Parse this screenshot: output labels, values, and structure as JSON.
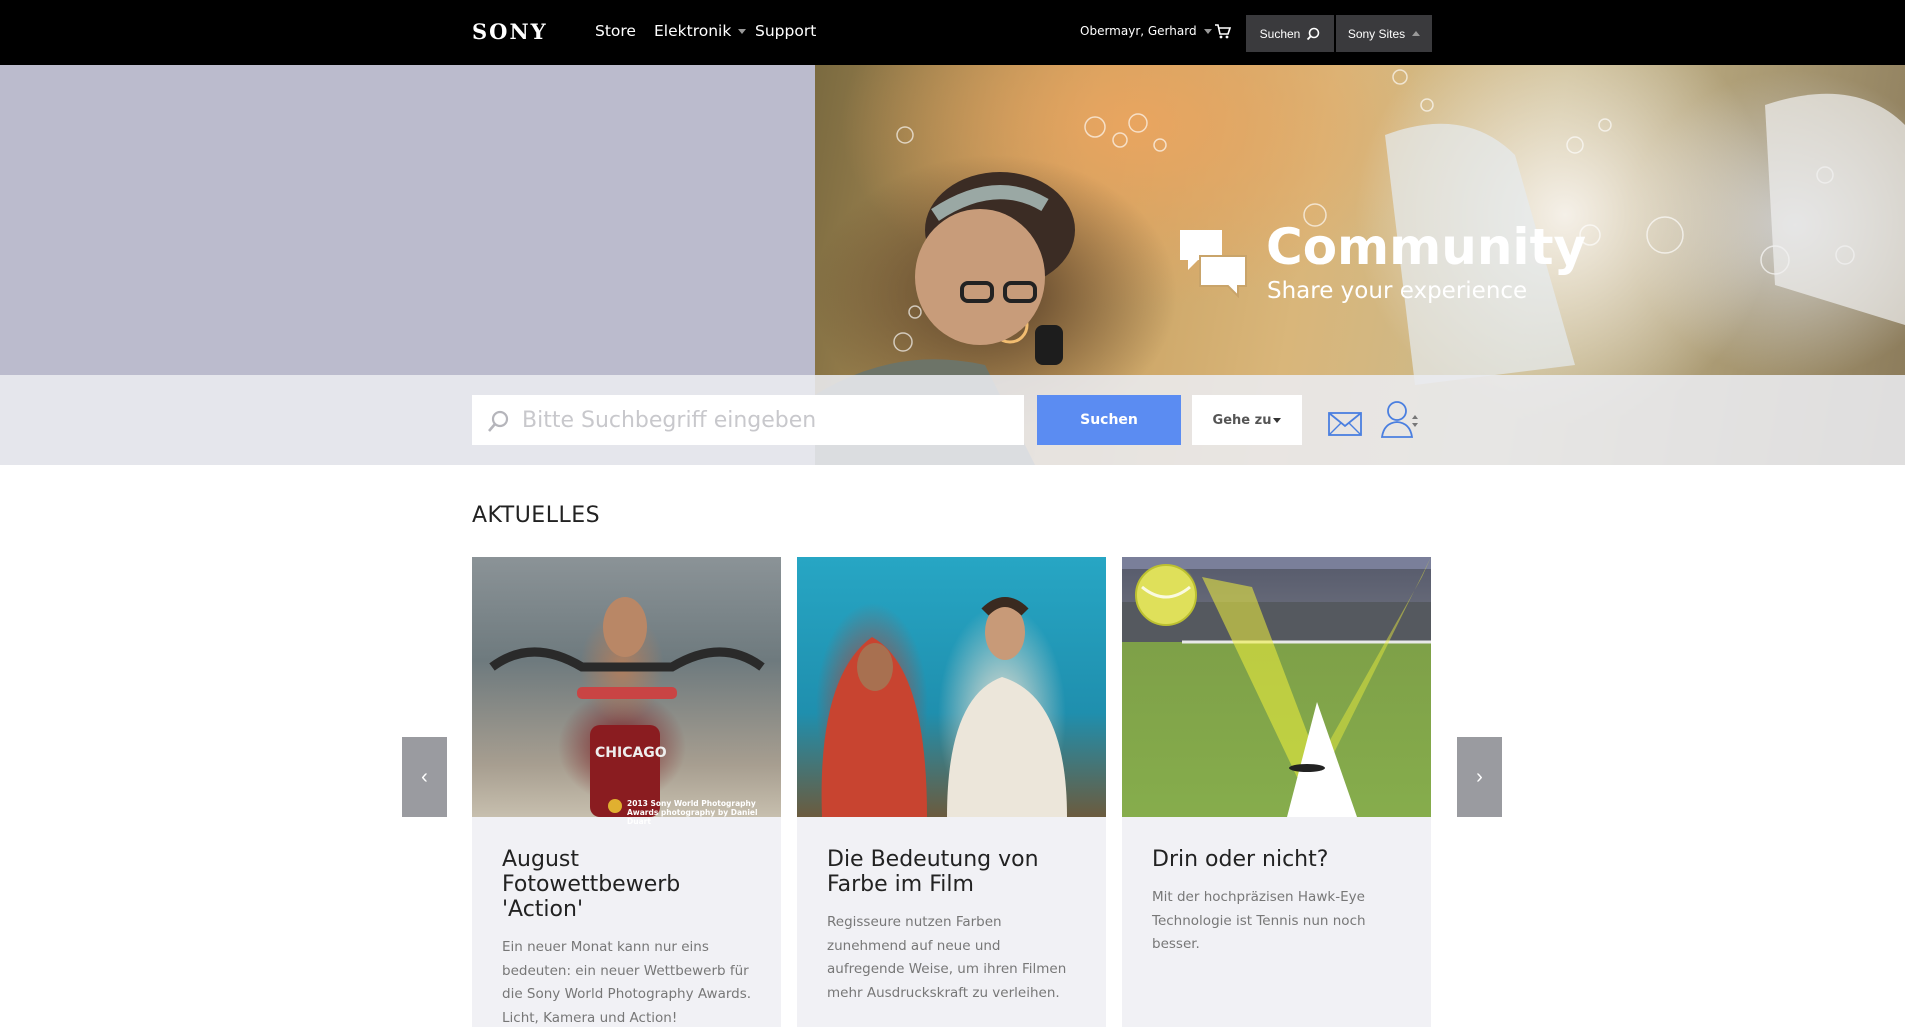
{
  "nav": {
    "logo": "SONY",
    "links": [
      "Store",
      "Elektronik",
      "Support"
    ],
    "user": "Obermayr, Gerhard",
    "search_label": "Suchen",
    "sites_label": "Sony Sites"
  },
  "hero": {
    "title": "Community",
    "subtitle": "Share your experience"
  },
  "search": {
    "placeholder": "Bitte Suchbegriff eingeben",
    "button": "Suchen",
    "goto": "Gehe zu"
  },
  "news": {
    "title": "AKTUELLES",
    "cards": [
      {
        "title": "August Fotowettbewerb 'Action'",
        "text": "Ein neuer Monat kann nur eins bedeuten: ein neuer Wettbewerb für die Sony World Photography Awards. Licht, Kamera und Action!",
        "badge": "2013 Sony World Photography Awards photography by Daniel Duart"
      },
      {
        "title": "Die Bedeutung von Farbe im Film",
        "text": "Regisseure nutzen Farben zunehmend auf neue und aufregende Weise, um ihren Filmen mehr Ausdruckskraft zu verleihen."
      },
      {
        "title": "Drin oder nicht?",
        "text": "Mit der hochpräzisen Hawk-Eye Technologie ist Tennis nun noch besser."
      }
    ],
    "prev": "‹",
    "next": "›"
  },
  "colors": {
    "nav_bg": "#000000",
    "accent": "#5b8cf2",
    "card_bg": "#f1f1f5",
    "hero_left": "#bbbbcd"
  }
}
